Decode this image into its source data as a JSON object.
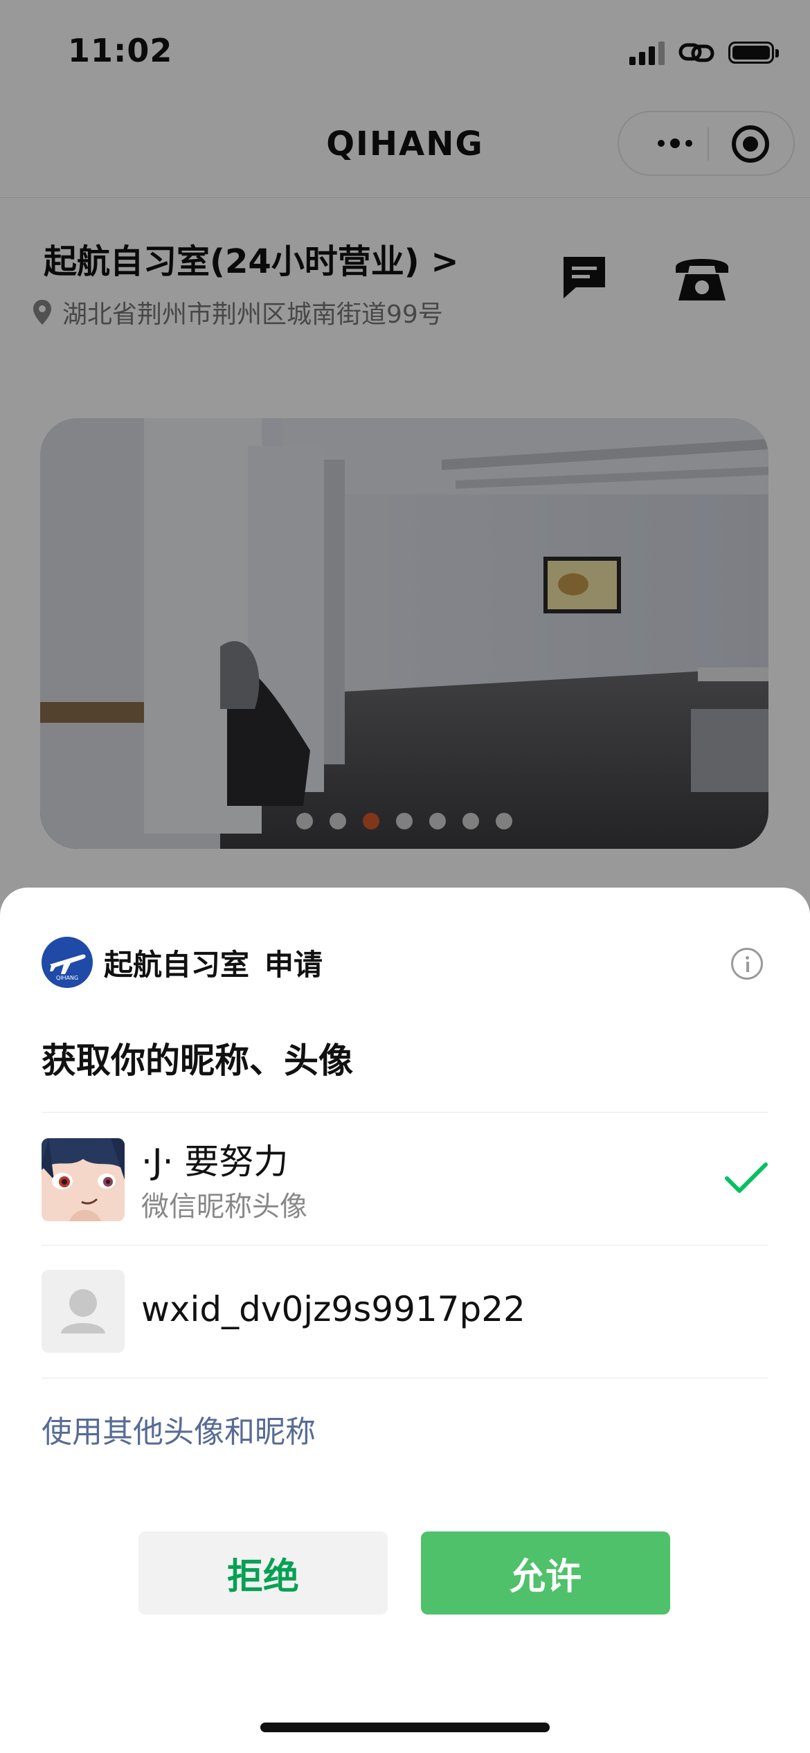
{
  "status_bar": {
    "time": "11:02"
  },
  "nav": {
    "title": "QIHANG"
  },
  "shop": {
    "title": "起航自习室(24小时营业) >",
    "address": "湖北省荆州市荆州区城南街道99号"
  },
  "banner": {
    "dot_count": 7,
    "active_index": 2,
    "active_color": "#d95a2b"
  },
  "dialog": {
    "app_name": "起航自习室",
    "request_label": "申请",
    "logo_text": "QIHANG",
    "heading": "获取你的昵称、头像",
    "options": [
      {
        "name": "·J· 要努力",
        "subtitle": "微信昵称头像",
        "selected": true
      },
      {
        "name": "wxid_dv0jz9s9917p22",
        "selected": false
      }
    ],
    "other_link": "使用其他头像和昵称",
    "reject_label": "拒绝",
    "allow_label": "允许"
  },
  "colors": {
    "allow_green": "#4fc16a",
    "reject_text_green": "#07a154",
    "link_blue": "#576b95",
    "check_green": "#07c160"
  }
}
